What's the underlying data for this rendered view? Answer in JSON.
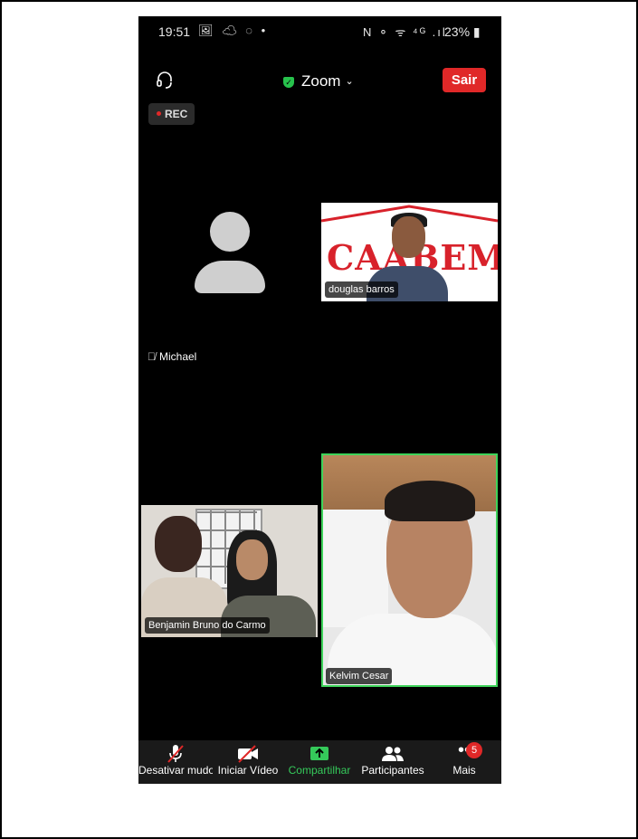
{
  "status_bar": {
    "time": "19:51",
    "left_icons": "🖼 ☁ ◌ •",
    "right_icons": "N ⚬ ᯤ ⁴ᴳ .ıl",
    "battery": "23% ▮"
  },
  "top_bar": {
    "meeting_title": "Zoom",
    "leave_label": "Sair"
  },
  "recording": {
    "label": "REC"
  },
  "participants": {
    "michael": {
      "name": "Michael"
    },
    "douglas": {
      "name": "douglas barros",
      "background_text": "CAABEM"
    },
    "benjamin": {
      "name": "Benjamin Bruno do Carmo"
    },
    "kelvim": {
      "name": "Kelvim Cesar"
    }
  },
  "toolbar": {
    "mute_label": "Desativar mudo",
    "video_label": "Iniciar Vídeo",
    "share_label": "Compartilhar",
    "participants_label": "Participantes",
    "more_label": "Mais",
    "more_badge": "5"
  },
  "nav_bar": {
    "recent": "|||",
    "home": "◯",
    "back": "‹"
  },
  "colors": {
    "leave": "#e02828",
    "share": "#35c95a",
    "active_speaker_border": "#3ed35a",
    "background": "#000000"
  }
}
